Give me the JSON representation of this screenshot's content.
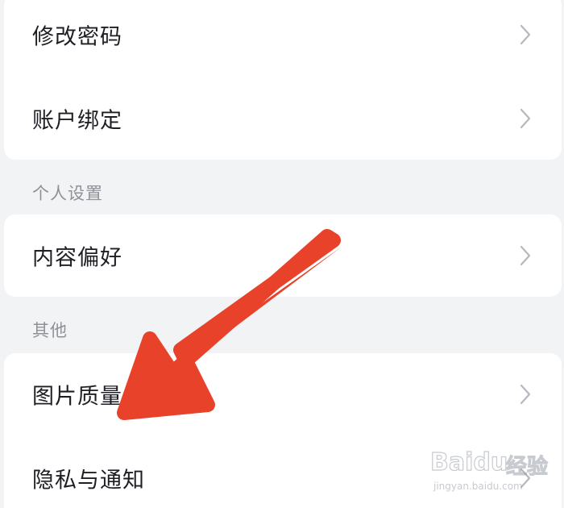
{
  "account_card": {
    "items": [
      {
        "label": "修改密码"
      },
      {
        "label": "账户绑定"
      }
    ]
  },
  "personal_section": {
    "title": "个人设置",
    "items": [
      {
        "label": "内容偏好"
      }
    ]
  },
  "other_section": {
    "title": "其他",
    "items": [
      {
        "label": "图片质量"
      },
      {
        "label": "隐私与通知"
      }
    ]
  },
  "annotation": {
    "arrow_color": "#e8432a",
    "arrow_target": "图片质量"
  },
  "watermark": {
    "brand": "Baidu",
    "sub": "经验",
    "url": "jingyan.baidu.com"
  },
  "colors": {
    "background": "#f2f3f5",
    "card": "#ffffff",
    "text": "#1e1f24",
    "section_text": "#8e9198",
    "chevron": "#b5b8be"
  }
}
